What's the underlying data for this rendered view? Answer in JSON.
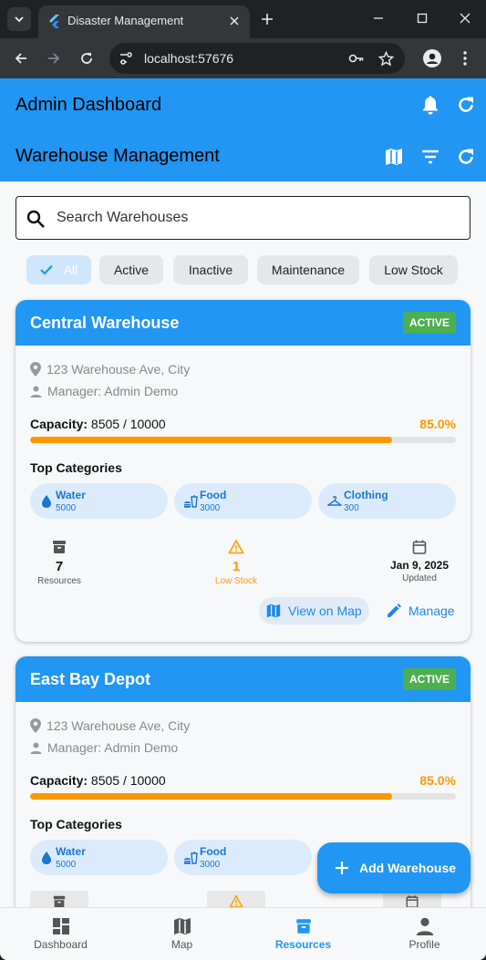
{
  "browser": {
    "tab_title": "Disaster Management",
    "url": "localhost:57676"
  },
  "app": {
    "dashboard_title": "Admin Dashboard",
    "section_title": "Warehouse Management",
    "search_placeholder": "Search Warehouses",
    "filters": [
      "All",
      "Active",
      "Inactive",
      "Maintenance",
      "Low Stock"
    ],
    "selected_filter": "All"
  },
  "warehouses": [
    {
      "name": "Central Warehouse",
      "status": "ACTIVE",
      "address": "123 Warehouse Ave, City",
      "manager": "Manager: Admin Demo",
      "capacity_label": "Capacity:",
      "capacity_value": "8505 / 10000",
      "capacity_percent": "85.0%",
      "capacity_fraction": 0.8505,
      "top_categories_label": "Top Categories",
      "categories": [
        {
          "name": "Water",
          "value": "5000"
        },
        {
          "name": "Food",
          "value": "3000"
        },
        {
          "name": "Clothing",
          "value": "300"
        }
      ],
      "stats": {
        "resources_value": "7",
        "resources_label": "Resources",
        "low_stock_value": "1",
        "low_stock_label": "Low Stock",
        "updated_value": "Jan 9, 2025",
        "updated_label": "Updated"
      },
      "view_on_map": "View on Map",
      "manage": "Manage"
    },
    {
      "name": "East Bay Depot",
      "status": "ACTIVE",
      "address": "123 Warehouse Ave, City",
      "manager": "Manager: Admin Demo",
      "capacity_label": "Capacity:",
      "capacity_value": "8505 / 10000",
      "capacity_percent": "85.0%",
      "capacity_fraction": 0.8505,
      "top_categories_label": "Top Categories",
      "categories": [
        {
          "name": "Water",
          "value": "5000"
        },
        {
          "name": "Food",
          "value": "3000"
        }
      ]
    }
  ],
  "fab_label": "Add Warehouse",
  "bottom_nav": [
    "Dashboard",
    "Map",
    "Resources",
    "Profile"
  ],
  "active_nav": "Resources",
  "colors": {
    "primary": "#2196f3",
    "active_badge": "#4caf50",
    "warning": "#ff9800"
  }
}
